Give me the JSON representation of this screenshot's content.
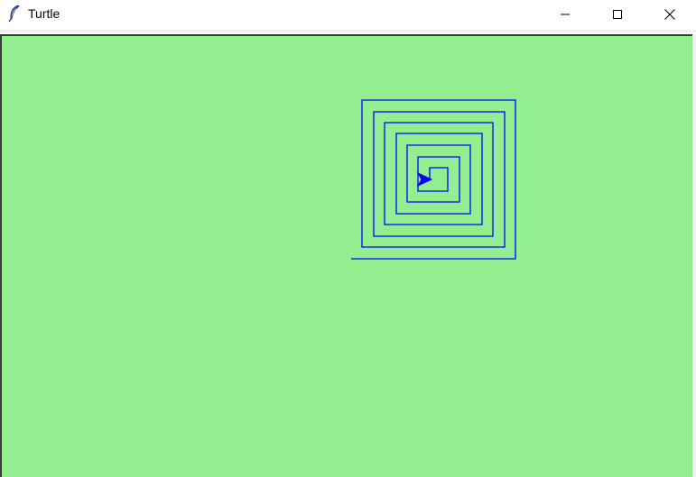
{
  "window": {
    "title": "Turtle",
    "app_icon": "feather-icon",
    "controls": {
      "minimize_icon": "minimize-icon",
      "maximize_icon": "maximize-icon",
      "close_icon": "close-icon"
    }
  },
  "canvas": {
    "background_color": "#93ee90",
    "pen_color": "#0000ff",
    "turtle_heading": "east",
    "turtle_icon": "arrow-turtle-icon"
  }
}
